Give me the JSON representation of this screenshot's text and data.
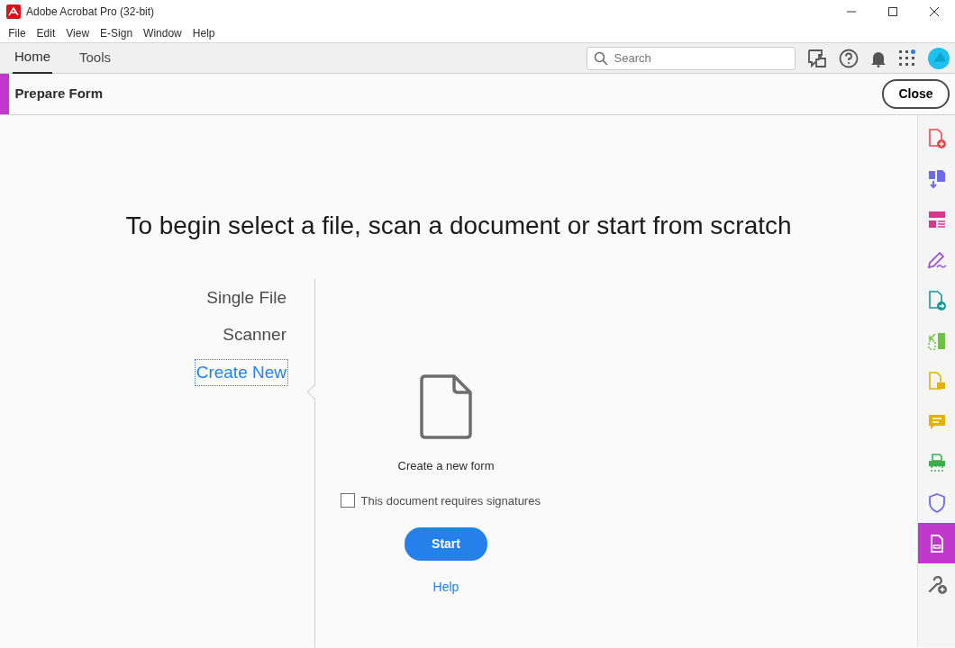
{
  "window": {
    "title": "Adobe Acrobat Pro (32-bit)"
  },
  "menu": [
    "File",
    "Edit",
    "View",
    "E-Sign",
    "Window",
    "Help"
  ],
  "tabs": [
    {
      "label": "Home",
      "selected": true
    },
    {
      "label": "Tools",
      "selected": false
    }
  ],
  "search": {
    "placeholder": "Search"
  },
  "tool_header": {
    "title": "Prepare Form",
    "close": "Close"
  },
  "heading": "To begin select a file, scan a document or start from scratch",
  "sources": [
    {
      "label": "Single File",
      "selected": false
    },
    {
      "label": "Scanner",
      "selected": false
    },
    {
      "label": "Create New",
      "selected": true
    }
  ],
  "panel": {
    "caption": "Create a new form",
    "checkbox": {
      "label": "This document requires signatures",
      "checked": false
    },
    "start": "Start",
    "help": "Help"
  },
  "rail": [
    {
      "kind": "page-plus",
      "color": "#e34850",
      "selected": false
    },
    {
      "kind": "page-down",
      "color": "#6e6ae8",
      "selected": false
    },
    {
      "kind": "layout",
      "color": "#d83790",
      "selected": false
    },
    {
      "kind": "pen",
      "color": "#9a57d9",
      "selected": false
    },
    {
      "kind": "page-arrow",
      "color": "#12979b",
      "selected": false
    },
    {
      "kind": "split",
      "color": "#6dc245",
      "selected": false
    },
    {
      "kind": "page-note",
      "color": "#dfb300",
      "selected": false
    },
    {
      "kind": "comment",
      "color": "#dfb300",
      "selected": false
    },
    {
      "kind": "printer",
      "color": "#3dae4c",
      "selected": false
    },
    {
      "kind": "shield",
      "color": "#6e6ae8",
      "selected": false
    },
    {
      "kind": "form",
      "color": "#c038cc",
      "selected": true
    },
    {
      "kind": "wrench",
      "color": "#666666",
      "selected": false
    }
  ]
}
